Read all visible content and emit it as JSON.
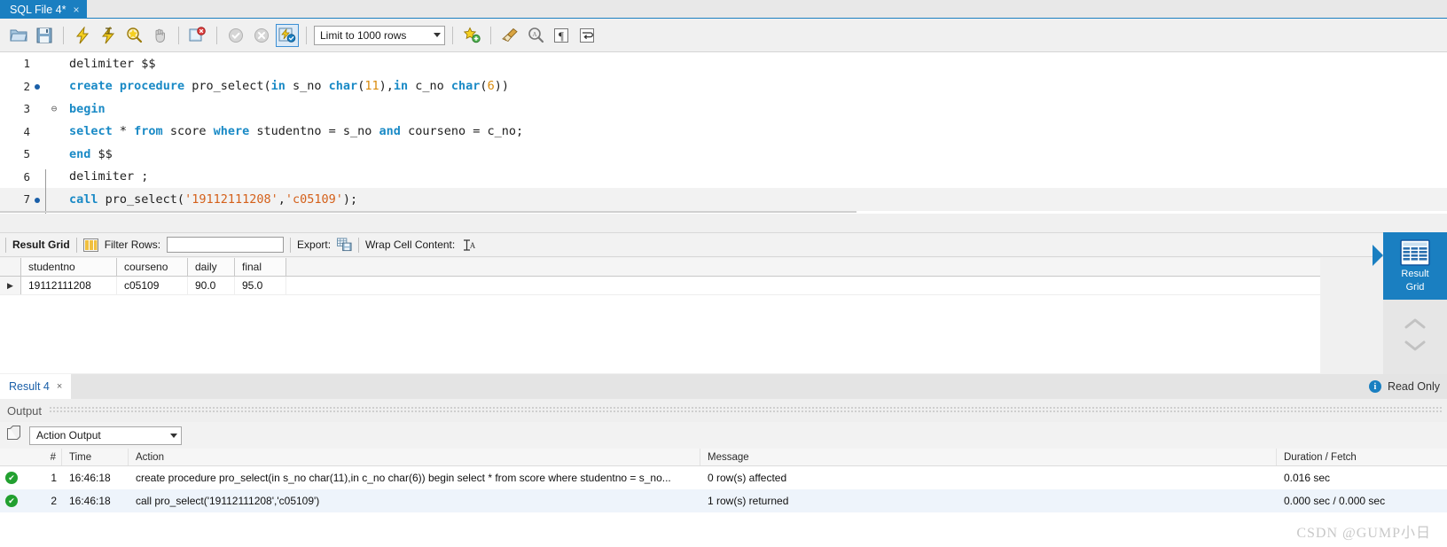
{
  "window": {
    "tab_label": "SQL File 4*",
    "tab_close": "×"
  },
  "toolbar": {
    "open_icon": "folder-open-icon",
    "save_icon": "save-icon",
    "execute_icon": "lightning-execute-icon",
    "execute_current_icon": "lightning-execute-current-icon",
    "explain_icon": "magnifier-explain-icon",
    "stop_icon": "hand-stop-icon",
    "toggle_stop_icon": "stop-on-error-icon",
    "commit_icon": "commit-check-icon",
    "rollback_icon": "rollback-x-icon",
    "autocommit_icon": "autocommit-icon",
    "limit_label": "Limit to 1000 rows",
    "snippet_icon": "star-add-snippet-icon",
    "beautify_icon": "broom-beautify-icon",
    "find_icon": "find-magnifier-icon",
    "invisible_chars_icon": "pilcrow-icon",
    "wrap_lines_icon": "wrap-lines-icon"
  },
  "editor": {
    "lines": [
      {
        "num": "1",
        "breakpoint": false,
        "fold": "",
        "highlight": false,
        "tokens": [
          {
            "t": "delimiter $$",
            "c": "op"
          }
        ]
      },
      {
        "num": "2",
        "breakpoint": true,
        "fold": "",
        "highlight": false,
        "tokens": [
          {
            "t": "create",
            "c": "kw"
          },
          {
            "t": " ",
            "c": "op"
          },
          {
            "t": "procedure",
            "c": "kw"
          },
          {
            "t": " pro_select(",
            "c": "op"
          },
          {
            "t": "in",
            "c": "kw"
          },
          {
            "t": " s_no ",
            "c": "op"
          },
          {
            "t": "char",
            "c": "kw"
          },
          {
            "t": "(",
            "c": "op"
          },
          {
            "t": "11",
            "c": "num"
          },
          {
            "t": "),",
            "c": "op"
          },
          {
            "t": "in",
            "c": "kw"
          },
          {
            "t": " c_no ",
            "c": "op"
          },
          {
            "t": "char",
            "c": "kw"
          },
          {
            "t": "(",
            "c": "op"
          },
          {
            "t": "6",
            "c": "num"
          },
          {
            "t": "))",
            "c": "op"
          }
        ]
      },
      {
        "num": "3",
        "breakpoint": false,
        "fold": "⊖",
        "highlight": false,
        "tokens": [
          {
            "t": "begin",
            "c": "kw"
          }
        ]
      },
      {
        "num": "4",
        "breakpoint": false,
        "fold": "",
        "highlight": false,
        "tokens": [
          {
            "t": "select",
            "c": "kw"
          },
          {
            "t": " * ",
            "c": "op"
          },
          {
            "t": "from",
            "c": "kw"
          },
          {
            "t": " score ",
            "c": "op"
          },
          {
            "t": "where",
            "c": "kw"
          },
          {
            "t": " studentno = s_no ",
            "c": "op"
          },
          {
            "t": "and",
            "c": "kw"
          },
          {
            "t": " courseno = c_no;",
            "c": "op"
          }
        ]
      },
      {
        "num": "5",
        "breakpoint": false,
        "fold": "",
        "highlight": false,
        "tokens": [
          {
            "t": "end",
            "c": "kw"
          },
          {
            "t": " $$",
            "c": "op"
          }
        ]
      },
      {
        "num": "6",
        "breakpoint": false,
        "fold": "",
        "highlight": false,
        "tokens": [
          {
            "t": "delimiter ;",
            "c": "op"
          }
        ]
      },
      {
        "num": "7",
        "breakpoint": true,
        "fold": "",
        "highlight": true,
        "tokens": [
          {
            "t": "call",
            "c": "kw"
          },
          {
            "t": " pro_select(",
            "c": "op"
          },
          {
            "t": "'19112111208'",
            "c": "str"
          },
          {
            "t": ",",
            "c": "op"
          },
          {
            "t": "'c05109'",
            "c": "str"
          },
          {
            "t": ");",
            "c": "op"
          }
        ]
      }
    ]
  },
  "result_toolbar": {
    "title": "Result Grid",
    "grid_view_icon": "grid-view-icon",
    "filter_label": "Filter Rows:",
    "filter_value": "",
    "filter_placeholder": "",
    "export_label": "Export:",
    "export_icon": "export-icon",
    "wrap_label": "Wrap Cell Content:",
    "wrap_icon": "wrap-cell-icon",
    "panel_toggle_icon": "panel-toggle-icon"
  },
  "result_grid": {
    "columns": [
      "studentno",
      "courseno",
      "daily",
      "final"
    ],
    "rows": [
      {
        "marker": "▶",
        "cells": [
          "19112111208",
          "c05109",
          "90.0",
          "95.0"
        ]
      }
    ]
  },
  "side_panel": {
    "item_label_line1": "Result",
    "item_label_line2": "Grid",
    "item_icon": "result-grid-icon",
    "scroll_up_icon": "chevron-up-icon",
    "scroll_down_icon": "chevron-down-icon"
  },
  "result_tabs": {
    "tab_label": "Result 4",
    "tab_close": "×",
    "status_label": "Read Only",
    "status_icon": "info-icon",
    "status_icon_glyph": "i"
  },
  "output_panel": {
    "header": "Output",
    "selector_value": "Action Output",
    "selector_icon": "output-pages-icon",
    "columns": [
      "#",
      "Time",
      "Action",
      "Message",
      "Duration / Fetch"
    ],
    "rows": [
      {
        "status": "success",
        "status_glyph": "✔",
        "num": "1",
        "time": "16:46:18",
        "action": "create procedure pro_select(in s_no char(11),in c_no char(6)) begin select * from score where studentno = s_no...",
        "message": "0 row(s) affected",
        "duration": "0.016 sec"
      },
      {
        "status": "success",
        "status_glyph": "✔",
        "num": "2",
        "time": "16:46:18",
        "action": "call pro_select('19112111208','c05109')",
        "message": "1 row(s) returned",
        "duration": "0.000 sec / 0.000 sec"
      }
    ]
  },
  "watermark": {
    "text": "CSDN @GUMP小日"
  },
  "colors": {
    "accent_blue": "#1a7fc1",
    "keyword_blue": "#1a8ac6",
    "number_orange": "#d98a0b",
    "string_orange": "#d4601a",
    "success_green": "#22a030"
  }
}
